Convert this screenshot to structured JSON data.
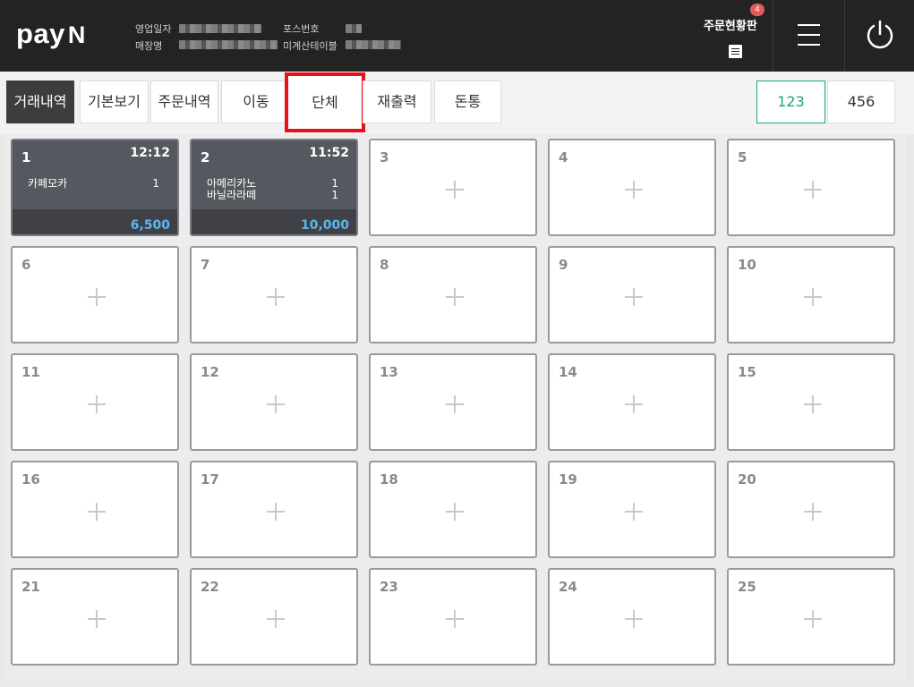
{
  "header": {
    "logo_text": "pay",
    "logo_n": "N",
    "business_date_label": "영업일자",
    "store_name_label": "매장명",
    "pos_number_label": "포스번호",
    "unpaid_tables_label": "미계산테이블",
    "order_board_label": "주문현황판",
    "order_badge_count": "4"
  },
  "toolbar": {
    "buttons": [
      {
        "label": "거래내역"
      },
      {
        "label": "기본보기"
      },
      {
        "label": "주문내역"
      },
      {
        "label": "이동"
      },
      {
        "label": "단체"
      },
      {
        "label": "재출력"
      },
      {
        "label": "돈통"
      }
    ],
    "pages": [
      {
        "label": "123"
      },
      {
        "label": "456"
      }
    ]
  },
  "tables": [
    {
      "number": "1",
      "occupied": true,
      "time": "12:12",
      "items": [
        {
          "name": "카페모카",
          "qty": "1"
        }
      ],
      "total": "6,500"
    },
    {
      "number": "2",
      "occupied": true,
      "time": "11:52",
      "items": [
        {
          "name": "아메리카노",
          "qty": "1"
        },
        {
          "name": "바닐라라떼",
          "qty": "1"
        }
      ],
      "total": "10,000"
    },
    {
      "number": "3"
    },
    {
      "number": "4"
    },
    {
      "number": "5"
    },
    {
      "number": "6"
    },
    {
      "number": "7"
    },
    {
      "number": "8"
    },
    {
      "number": "9"
    },
    {
      "number": "10"
    },
    {
      "number": "11"
    },
    {
      "number": "12"
    },
    {
      "number": "13"
    },
    {
      "number": "14"
    },
    {
      "number": "15"
    },
    {
      "number": "16"
    },
    {
      "number": "17"
    },
    {
      "number": "18"
    },
    {
      "number": "19"
    },
    {
      "number": "20"
    },
    {
      "number": "21"
    },
    {
      "number": "22"
    },
    {
      "number": "23"
    },
    {
      "number": "24"
    },
    {
      "number": "25"
    }
  ],
  "colors": {
    "header_bg": "#232323",
    "occupied_card": "#55585f",
    "total_blue": "#59b7f0",
    "page_active_green": "#19a77a",
    "highlight_red": "#e8101a",
    "badge_red": "#e45a5a"
  }
}
